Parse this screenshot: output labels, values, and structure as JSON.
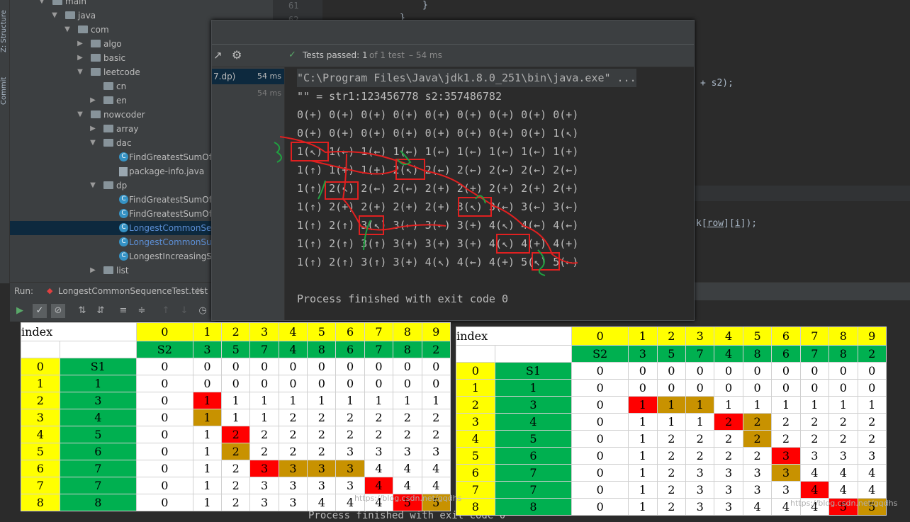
{
  "side_tabs": {
    "structure": "Z: Structure",
    "commit": "Commit"
  },
  "tree": [
    {
      "label": "main",
      "indent": 0,
      "kind": "folder",
      "arrow": "open"
    },
    {
      "label": "java",
      "indent": 1,
      "kind": "folder",
      "arrow": "open"
    },
    {
      "label": "com",
      "indent": 2,
      "kind": "folder",
      "arrow": "open"
    },
    {
      "label": "algo",
      "indent": 3,
      "kind": "folder",
      "arrow": "closed"
    },
    {
      "label": "basic",
      "indent": 3,
      "kind": "folder",
      "arrow": "closed"
    },
    {
      "label": "leetcode",
      "indent": 3,
      "kind": "folder",
      "arrow": "open"
    },
    {
      "label": "cn",
      "indent": 4,
      "kind": "folder",
      "arrow": ""
    },
    {
      "label": "en",
      "indent": 4,
      "kind": "folder",
      "arrow": "closed"
    },
    {
      "label": "nowcoder",
      "indent": 3,
      "kind": "folder",
      "arrow": "open"
    },
    {
      "label": "array",
      "indent": 4,
      "kind": "folder",
      "arrow": "closed"
    },
    {
      "label": "dac",
      "indent": 4,
      "kind": "folder",
      "arrow": "open"
    },
    {
      "label": "FindGreatestSumOfSub",
      "indent": 5,
      "kind": "class",
      "arrow": ""
    },
    {
      "label": "package-info.java",
      "indent": 5,
      "kind": "java",
      "arrow": ""
    },
    {
      "label": "dp",
      "indent": 4,
      "kind": "folder",
      "arrow": "open"
    },
    {
      "label": "FindGreatestSumOfSub",
      "indent": 5,
      "kind": "class",
      "arrow": ""
    },
    {
      "label": "FindGreatestSumOfSub",
      "indent": 5,
      "kind": "class",
      "arrow": ""
    },
    {
      "label": "LongestCommonSeque",
      "indent": 5,
      "kind": "class",
      "arrow": "",
      "selected": true
    },
    {
      "label": "LongestCommonSubst",
      "indent": 5,
      "kind": "class",
      "arrow": "",
      "blue": true
    },
    {
      "label": "LongestIncreasingSubs",
      "indent": 5,
      "kind": "class",
      "arrow": ""
    },
    {
      "label": "list",
      "indent": 4,
      "kind": "folder",
      "arrow": "closed"
    }
  ],
  "editor": {
    "line_numbers": [
      "61",
      "62"
    ],
    "brace1": "}",
    "brace2": "}",
    "frag1": "+ s2);",
    "frag2": "k[row][i]);",
    "frag2_k": "k[",
    "frag2_row": "row",
    "frag2_mid": "][",
    "frag2_i": "i",
    "frag2_end": "]);"
  },
  "run": {
    "label": "Run:",
    "tab": "LongestCommonSequenceTest.test",
    "close": "×"
  },
  "popup": {
    "tests_passed": "Tests passed:",
    "count": "1",
    "of": "of 1 test",
    "time": "– 54 ms",
    "items": [
      {
        "name": "7.dp)",
        "time": "54 ms"
      },
      {
        "name": "",
        "time": "54 ms"
      }
    ],
    "console": [
      "\"C:\\Program Files\\Java\\jdk1.8.0_251\\bin\\java.exe\" ...",
      "\"\" = str1:123456778 s2:357486782",
      "0(+) 0(+) 0(+) 0(+) 0(+) 0(+) 0(+) 0(+) 0(+)",
      "0(+) 0(+) 0(+) 0(+) 0(+) 0(+) 0(+) 0(+) 1(↖)",
      "1(↖) 1(←) 1(←) 1(←) 1(←) 1(←) 1(←) 1(←) 1(+)",
      "1(↑) 1(+) 1(+) 2(↖) 2(←) 2(←) 2(←) 2(←) 2(←)",
      "1(↑) 2(↖) 2(←) 2(←) 2(+) 2(+) 2(+) 2(+) 2(+)",
      "1(↑) 2(+) 2(+) 2(+) 2(+) 3(↖) 3(←) 3(←) 3(←)",
      "1(↑) 2(↑) 3(↖) 3(←) 3(←) 3(+) 4(↖) 4(←) 4(←)",
      "1(↑) 2(↑) 3(↑) 3(+) 3(+) 3(+) 4(↖) 4(+) 4(+)",
      "1(↑) 2(↑) 3(↑) 3(+) 4(↖) 4(←) 4(+) 5(↖) 5(←)",
      "",
      "Process finished with exit code 0"
    ]
  },
  "bottom_text": "Process finished with exit code 0",
  "watermark": "https://blog.csdn.net/gqdhs",
  "colors": {
    "yellow": "#ffff00",
    "green": "#00b050",
    "red": "#ff0000",
    "orange": "#c89200"
  },
  "table_left": {
    "rows": [
      [
        {
          "t": "index",
          "c": "w",
          "cs": 2
        },
        {
          "t": "0",
          "c": "y"
        },
        {
          "t": "1",
          "c": "y"
        },
        {
          "t": "2",
          "c": "y"
        },
        {
          "t": "3",
          "c": "y"
        },
        {
          "t": "4",
          "c": "y"
        },
        {
          "t": "5",
          "c": "y"
        },
        {
          "t": "6",
          "c": "y"
        },
        {
          "t": "7",
          "c": "y"
        },
        {
          "t": "8",
          "c": "y"
        },
        {
          "t": "9",
          "c": "y"
        }
      ],
      [
        {
          "t": "",
          "c": "w"
        },
        {
          "t": "",
          "c": "w"
        },
        {
          "t": "S2",
          "c": "g"
        },
        {
          "t": "3",
          "c": "g"
        },
        {
          "t": "5",
          "c": "g"
        },
        {
          "t": "7",
          "c": "g"
        },
        {
          "t": "4",
          "c": "g"
        },
        {
          "t": "8",
          "c": "g"
        },
        {
          "t": "6",
          "c": "g"
        },
        {
          "t": "7",
          "c": "g"
        },
        {
          "t": "8",
          "c": "g"
        },
        {
          "t": "2",
          "c": "g"
        }
      ],
      [
        {
          "t": "0",
          "c": "y"
        },
        {
          "t": "S1",
          "c": "g"
        },
        {
          "t": "0"
        },
        {
          "t": "0"
        },
        {
          "t": "0"
        },
        {
          "t": "0"
        },
        {
          "t": "0"
        },
        {
          "t": "0"
        },
        {
          "t": "0"
        },
        {
          "t": "0"
        },
        {
          "t": "0"
        },
        {
          "t": "0"
        }
      ],
      [
        {
          "t": "1",
          "c": "y"
        },
        {
          "t": "1",
          "c": "g"
        },
        {
          "t": "0"
        },
        {
          "t": "0"
        },
        {
          "t": "0"
        },
        {
          "t": "0"
        },
        {
          "t": "0"
        },
        {
          "t": "0"
        },
        {
          "t": "0"
        },
        {
          "t": "0"
        },
        {
          "t": "0"
        },
        {
          "t": "0"
        }
      ],
      [
        {
          "t": "2",
          "c": "y"
        },
        {
          "t": "3",
          "c": "g"
        },
        {
          "t": "0"
        },
        {
          "t": "1",
          "c": "r"
        },
        {
          "t": "1"
        },
        {
          "t": "1"
        },
        {
          "t": "1"
        },
        {
          "t": "1"
        },
        {
          "t": "1"
        },
        {
          "t": "1"
        },
        {
          "t": "1"
        },
        {
          "t": "1"
        }
      ],
      [
        {
          "t": "3",
          "c": "y"
        },
        {
          "t": "4",
          "c": "g"
        },
        {
          "t": "0"
        },
        {
          "t": "1",
          "c": "o"
        },
        {
          "t": "1"
        },
        {
          "t": "1"
        },
        {
          "t": "2"
        },
        {
          "t": "2"
        },
        {
          "t": "2"
        },
        {
          "t": "2"
        },
        {
          "t": "2"
        },
        {
          "t": "2"
        }
      ],
      [
        {
          "t": "4",
          "c": "y"
        },
        {
          "t": "5",
          "c": "g"
        },
        {
          "t": "0"
        },
        {
          "t": "1"
        },
        {
          "t": "2",
          "c": "r"
        },
        {
          "t": "2"
        },
        {
          "t": "2"
        },
        {
          "t": "2"
        },
        {
          "t": "2"
        },
        {
          "t": "2"
        },
        {
          "t": "2"
        },
        {
          "t": "2"
        }
      ],
      [
        {
          "t": "5",
          "c": "y"
        },
        {
          "t": "6",
          "c": "g"
        },
        {
          "t": "0"
        },
        {
          "t": "1"
        },
        {
          "t": "2",
          "c": "o"
        },
        {
          "t": "2"
        },
        {
          "t": "2"
        },
        {
          "t": "2"
        },
        {
          "t": "3"
        },
        {
          "t": "3"
        },
        {
          "t": "3"
        },
        {
          "t": "3"
        }
      ],
      [
        {
          "t": "6",
          "c": "y"
        },
        {
          "t": "7",
          "c": "g"
        },
        {
          "t": "0"
        },
        {
          "t": "1"
        },
        {
          "t": "2"
        },
        {
          "t": "3",
          "c": "r"
        },
        {
          "t": "3",
          "c": "o"
        },
        {
          "t": "3",
          "c": "o"
        },
        {
          "t": "3",
          "c": "o"
        },
        {
          "t": "4"
        },
        {
          "t": "4"
        },
        {
          "t": "4"
        }
      ],
      [
        {
          "t": "7",
          "c": "y"
        },
        {
          "t": "7",
          "c": "g"
        },
        {
          "t": "0"
        },
        {
          "t": "1"
        },
        {
          "t": "2"
        },
        {
          "t": "3"
        },
        {
          "t": "3"
        },
        {
          "t": "3"
        },
        {
          "t": "3"
        },
        {
          "t": "4",
          "c": "r"
        },
        {
          "t": "4"
        },
        {
          "t": "4"
        }
      ],
      [
        {
          "t": "8",
          "c": "y"
        },
        {
          "t": "8",
          "c": "g"
        },
        {
          "t": "0"
        },
        {
          "t": "1"
        },
        {
          "t": "2"
        },
        {
          "t": "3"
        },
        {
          "t": "3"
        },
        {
          "t": "4"
        },
        {
          "t": "4"
        },
        {
          "t": "4"
        },
        {
          "t": "5",
          "c": "r"
        },
        {
          "t": "5",
          "c": "o"
        }
      ]
    ]
  },
  "table_right": {
    "rows": [
      [
        {
          "t": "index",
          "c": "w",
          "cs": 2
        },
        {
          "t": "0",
          "c": "y"
        },
        {
          "t": "1",
          "c": "y"
        },
        {
          "t": "2",
          "c": "y"
        },
        {
          "t": "3",
          "c": "y"
        },
        {
          "t": "4",
          "c": "y"
        },
        {
          "t": "5",
          "c": "y"
        },
        {
          "t": "6",
          "c": "y"
        },
        {
          "t": "7",
          "c": "y"
        },
        {
          "t": "8",
          "c": "y"
        },
        {
          "t": "9",
          "c": "y"
        }
      ],
      [
        {
          "t": "",
          "c": "w"
        },
        {
          "t": "",
          "c": "w"
        },
        {
          "t": "S2",
          "c": "g"
        },
        {
          "t": "3",
          "c": "g"
        },
        {
          "t": "5",
          "c": "g"
        },
        {
          "t": "7",
          "c": "g"
        },
        {
          "t": "4",
          "c": "g"
        },
        {
          "t": "8",
          "c": "g"
        },
        {
          "t": "6",
          "c": "g"
        },
        {
          "t": "7",
          "c": "g"
        },
        {
          "t": "8",
          "c": "g"
        },
        {
          "t": "2",
          "c": "g"
        }
      ],
      [
        {
          "t": "0",
          "c": "y"
        },
        {
          "t": "S1",
          "c": "g"
        },
        {
          "t": "0"
        },
        {
          "t": "0"
        },
        {
          "t": "0"
        },
        {
          "t": "0"
        },
        {
          "t": "0"
        },
        {
          "t": "0"
        },
        {
          "t": "0"
        },
        {
          "t": "0"
        },
        {
          "t": "0"
        },
        {
          "t": "0"
        }
      ],
      [
        {
          "t": "1",
          "c": "y"
        },
        {
          "t": "1",
          "c": "g"
        },
        {
          "t": "0"
        },
        {
          "t": "0"
        },
        {
          "t": "0"
        },
        {
          "t": "0"
        },
        {
          "t": "0"
        },
        {
          "t": "0"
        },
        {
          "t": "0"
        },
        {
          "t": "0"
        },
        {
          "t": "0"
        },
        {
          "t": "0"
        }
      ],
      [
        {
          "t": "2",
          "c": "y"
        },
        {
          "t": "3",
          "c": "g"
        },
        {
          "t": "0"
        },
        {
          "t": "1",
          "c": "r"
        },
        {
          "t": "1",
          "c": "o"
        },
        {
          "t": "1",
          "c": "o"
        },
        {
          "t": "1"
        },
        {
          "t": "1"
        },
        {
          "t": "1"
        },
        {
          "t": "1"
        },
        {
          "t": "1"
        },
        {
          "t": "1"
        }
      ],
      [
        {
          "t": "3",
          "c": "y"
        },
        {
          "t": "4",
          "c": "g"
        },
        {
          "t": "0"
        },
        {
          "t": "1"
        },
        {
          "t": "1"
        },
        {
          "t": "1"
        },
        {
          "t": "2",
          "c": "r"
        },
        {
          "t": "2",
          "c": "o"
        },
        {
          "t": "2"
        },
        {
          "t": "2"
        },
        {
          "t": "2"
        },
        {
          "t": "2"
        }
      ],
      [
        {
          "t": "4",
          "c": "y"
        },
        {
          "t": "5",
          "c": "g"
        },
        {
          "t": "0"
        },
        {
          "t": "1"
        },
        {
          "t": "2"
        },
        {
          "t": "2"
        },
        {
          "t": "2"
        },
        {
          "t": "2",
          "c": "o"
        },
        {
          "t": "2"
        },
        {
          "t": "2"
        },
        {
          "t": "2"
        },
        {
          "t": "2"
        }
      ],
      [
        {
          "t": "5",
          "c": "y"
        },
        {
          "t": "6",
          "c": "g"
        },
        {
          "t": "0"
        },
        {
          "t": "1"
        },
        {
          "t": "2"
        },
        {
          "t": "2"
        },
        {
          "t": "2"
        },
        {
          "t": "2"
        },
        {
          "t": "3",
          "c": "r"
        },
        {
          "t": "3"
        },
        {
          "t": "3"
        },
        {
          "t": "3"
        }
      ],
      [
        {
          "t": "6",
          "c": "y"
        },
        {
          "t": "7",
          "c": "g"
        },
        {
          "t": "0"
        },
        {
          "t": "1"
        },
        {
          "t": "2"
        },
        {
          "t": "3"
        },
        {
          "t": "3"
        },
        {
          "t": "3"
        },
        {
          "t": "3",
          "c": "o"
        },
        {
          "t": "4"
        },
        {
          "t": "4"
        },
        {
          "t": "4"
        }
      ],
      [
        {
          "t": "7",
          "c": "y"
        },
        {
          "t": "7",
          "c": "g"
        },
        {
          "t": "0"
        },
        {
          "t": "1"
        },
        {
          "t": "2"
        },
        {
          "t": "3"
        },
        {
          "t": "3"
        },
        {
          "t": "3"
        },
        {
          "t": "3"
        },
        {
          "t": "4",
          "c": "r"
        },
        {
          "t": "4"
        },
        {
          "t": "4"
        }
      ],
      [
        {
          "t": "8",
          "c": "y"
        },
        {
          "t": "8",
          "c": "g"
        },
        {
          "t": "0"
        },
        {
          "t": "1"
        },
        {
          "t": "2"
        },
        {
          "t": "3"
        },
        {
          "t": "3"
        },
        {
          "t": "4"
        },
        {
          "t": "4"
        },
        {
          "t": "4"
        },
        {
          "t": "5",
          "c": "r"
        },
        {
          "t": "5",
          "c": "o"
        }
      ]
    ]
  }
}
